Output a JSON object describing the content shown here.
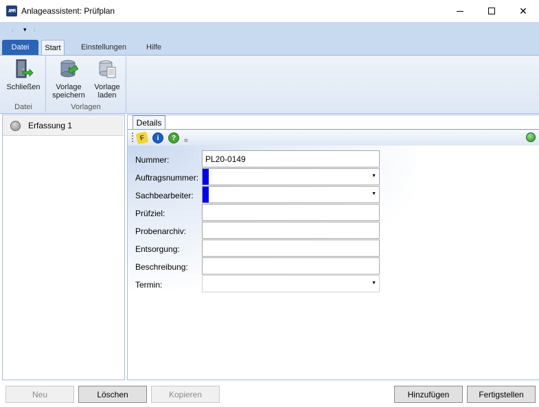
{
  "window": {
    "title": "Anlageassistent: Prüfplan",
    "app_icon_label": "AMM"
  },
  "qat": {
    "items": [
      "undo-arrow",
      "customize-dropdown"
    ]
  },
  "tabs": [
    {
      "label": "Datei"
    },
    {
      "label": "Start"
    },
    {
      "label": "Einstellungen"
    },
    {
      "label": "Hilfe"
    }
  ],
  "ribbon": {
    "groups": [
      {
        "label": "Datei",
        "buttons": [
          {
            "label_line1": "Schließen",
            "label_line2": "",
            "icon": "exit-door-icon"
          }
        ]
      },
      {
        "label": "Vorlagen",
        "buttons": [
          {
            "label_line1": "Vorlage",
            "label_line2": "speichern",
            "icon": "save-template-icon"
          },
          {
            "label_line1": "Vorlage",
            "label_line2": "laden",
            "icon": "load-template-icon"
          }
        ]
      }
    ]
  },
  "left_panel": {
    "items": [
      {
        "label": "Erfassung 1"
      }
    ]
  },
  "details": {
    "tab_label": "Details",
    "toolbar_icons": [
      "formula-icon",
      "info-icon",
      "help-icon"
    ],
    "fields": [
      {
        "label": "Nummer:",
        "value": "PL20-0149",
        "type": "text"
      },
      {
        "label": "Auftragsnummer:",
        "value": "",
        "type": "dropdown",
        "required": true
      },
      {
        "label": "Sachbearbeiter:",
        "value": "",
        "type": "dropdown",
        "required": true
      },
      {
        "label": "Prüfziel:",
        "value": "",
        "type": "text"
      },
      {
        "label": "Probenarchiv:",
        "value": "",
        "type": "text"
      },
      {
        "label": "Entsorgung:",
        "value": "",
        "type": "text"
      },
      {
        "label": "Beschreibung:",
        "value": "",
        "type": "text"
      },
      {
        "label": "Termin:",
        "value": "",
        "type": "dropdown"
      }
    ]
  },
  "buttons": {
    "neu": "Neu",
    "loeschen": "Löschen",
    "kopieren": "Kopieren",
    "hinzufuegen": "Hinzufügen",
    "fertigstellen": "Fertigstellen"
  },
  "colors": {
    "accent": "#2b63b5",
    "required_marker": "#0000e6",
    "status_ok": "#1f8a1f"
  }
}
